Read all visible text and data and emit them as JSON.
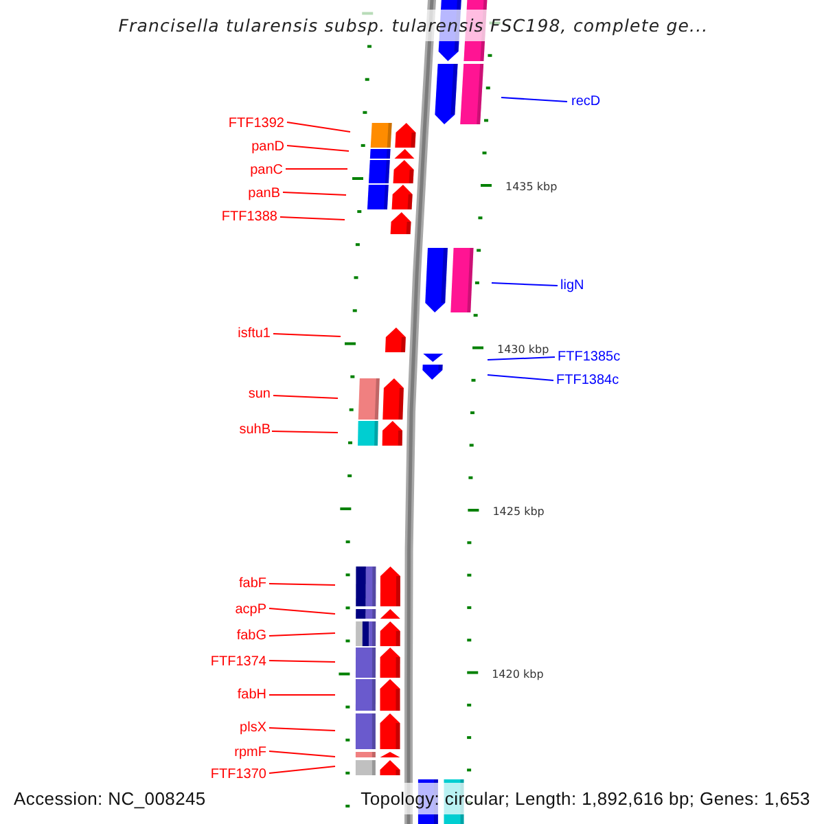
{
  "title": "Francisella tularensis subsp. tularensis FSC198, complete ge...",
  "scale": {
    "labels": [
      "1435 kbp",
      "1430 kbp",
      "1425 kbp",
      "1420 kbp"
    ]
  },
  "genes": [
    {
      "kind": "reverse",
      "color": "#ff1493"
    },
    {
      "kind": "reverse",
      "label": "recD",
      "color": "#ff1493"
    },
    {
      "kind": "forward",
      "label": "FTF1392",
      "color": "#ff8c00"
    },
    {
      "kind": "forward",
      "label": "panD",
      "color": "#0000ff"
    },
    {
      "kind": "forward",
      "label": "panC",
      "color": "#0000ff"
    },
    {
      "kind": "forward",
      "label": "panB",
      "color": "#0000ff"
    },
    {
      "kind": "forward",
      "label": "FTF1388"
    },
    {
      "kind": "reverse",
      "label": "ligN",
      "color": "#ff1493"
    },
    {
      "kind": "forward",
      "label": "isftu1"
    },
    {
      "kind": "reverse",
      "label": "FTF1385c"
    },
    {
      "kind": "reverse",
      "label": "FTF1384c"
    },
    {
      "kind": "forward",
      "label": "sun",
      "color": "#f08080"
    },
    {
      "kind": "forward",
      "label": "suhB",
      "color": "#00ced1"
    },
    {
      "kind": "forward",
      "label": "fabF",
      "segments": [
        {
          "color": "#000080"
        },
        {
          "color": "#6a5acd"
        }
      ]
    },
    {
      "kind": "forward",
      "label": "acpP",
      "segments": [
        {
          "color": "#000080"
        },
        {
          "color": "#6a5acd"
        }
      ]
    },
    {
      "kind": "forward",
      "label": "fabG",
      "segments": [
        {
          "color": "#c0c0c0"
        },
        {
          "color": "#000080"
        },
        {
          "color": "#6a5acd"
        }
      ]
    },
    {
      "kind": "forward",
      "label": "FTF1374",
      "color": "#6a5acd"
    },
    {
      "kind": "forward",
      "label": "fabH",
      "color": "#6a5acd"
    },
    {
      "kind": "forward",
      "label": "plsX",
      "color": "#6a5acd"
    },
    {
      "kind": "forward",
      "label": "rpmF",
      "color": "#f08080"
    },
    {
      "kind": "forward",
      "label": "FTF1370",
      "color": "#c0c0c0"
    },
    {
      "kind": "reverse",
      "color": "#00ced1"
    }
  ],
  "footer": {
    "accession": "Accession: NC_008245",
    "summary": "Topology: circular; Length: 1,892,616 bp; Genes: 1,653"
  }
}
